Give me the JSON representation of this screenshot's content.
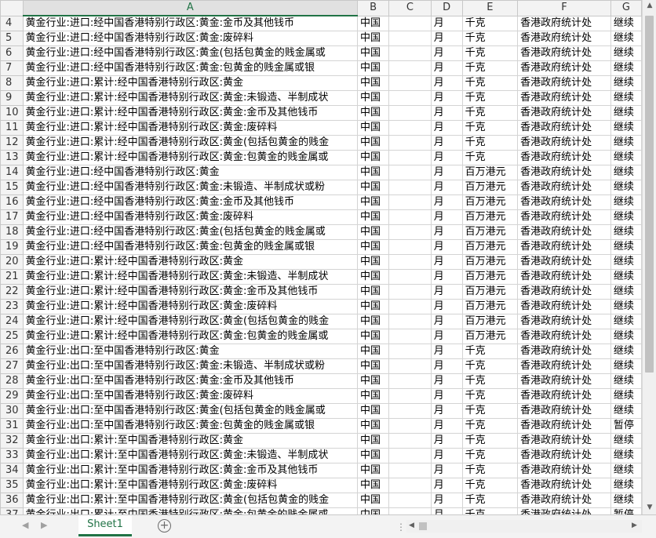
{
  "columns": [
    "A",
    "B",
    "C",
    "D",
    "E",
    "F",
    "G"
  ],
  "selected_column": "A",
  "rows": [
    [
      "4",
      "黄金行业:进口:经中国香港特别行政区:黄金:金币及其他钱币",
      "中国",
      "",
      "月",
      "千克",
      "香港政府统计处",
      "继续"
    ],
    [
      "5",
      "黄金行业:进口:经中国香港特别行政区:黄金:废碎料",
      "中国",
      "",
      "月",
      "千克",
      "香港政府统计处",
      "继续"
    ],
    [
      "6",
      "黄金行业:进口:经中国香港特别行政区:黄金(包括包黄金的贱金属或",
      "中国",
      "",
      "月",
      "千克",
      "香港政府统计处",
      "继续"
    ],
    [
      "7",
      "黄金行业:进口:经中国香港特别行政区:黄金:包黄金的贱金属或银",
      "中国",
      "",
      "月",
      "千克",
      "香港政府统计处",
      "继续"
    ],
    [
      "8",
      "黄金行业:进口:累计:经中国香港特别行政区:黄金",
      "中国",
      "",
      "月",
      "千克",
      "香港政府统计处",
      "继续"
    ],
    [
      "9",
      "黄金行业:进口:累计:经中国香港特别行政区:黄金:未锻造、半制成状",
      "中国",
      "",
      "月",
      "千克",
      "香港政府统计处",
      "继续"
    ],
    [
      "10",
      "黄金行业:进口:累计:经中国香港特别行政区:黄金:金币及其他钱币",
      "中国",
      "",
      "月",
      "千克",
      "香港政府统计处",
      "继续"
    ],
    [
      "11",
      "黄金行业:进口:累计:经中国香港特别行政区:黄金:废碎料",
      "中国",
      "",
      "月",
      "千克",
      "香港政府统计处",
      "继续"
    ],
    [
      "12",
      "黄金行业:进口:累计:经中国香港特别行政区:黄金(包括包黄金的贱金",
      "中国",
      "",
      "月",
      "千克",
      "香港政府统计处",
      "继续"
    ],
    [
      "13",
      "黄金行业:进口:累计:经中国香港特别行政区:黄金:包黄金的贱金属或",
      "中国",
      "",
      "月",
      "千克",
      "香港政府统计处",
      "继续"
    ],
    [
      "14",
      "黄金行业:进口:经中国香港特别行政区:黄金",
      "中国",
      "",
      "月",
      "百万港元",
      "香港政府统计处",
      "继续"
    ],
    [
      "15",
      "黄金行业:进口:经中国香港特别行政区:黄金:未锻造、半制成状或粉",
      "中国",
      "",
      "月",
      "百万港元",
      "香港政府统计处",
      "继续"
    ],
    [
      "16",
      "黄金行业:进口:经中国香港特别行政区:黄金:金币及其他钱币",
      "中国",
      "",
      "月",
      "百万港元",
      "香港政府统计处",
      "继续"
    ],
    [
      "17",
      "黄金行业:进口:经中国香港特别行政区:黄金:废碎料",
      "中国",
      "",
      "月",
      "百万港元",
      "香港政府统计处",
      "继续"
    ],
    [
      "18",
      "黄金行业:进口:经中国香港特别行政区:黄金(包括包黄金的贱金属或",
      "中国",
      "",
      "月",
      "百万港元",
      "香港政府统计处",
      "继续"
    ],
    [
      "19",
      "黄金行业:进口:经中国香港特别行政区:黄金:包黄金的贱金属或银",
      "中国",
      "",
      "月",
      "百万港元",
      "香港政府统计处",
      "继续"
    ],
    [
      "20",
      "黄金行业:进口:累计:经中国香港特别行政区:黄金",
      "中国",
      "",
      "月",
      "百万港元",
      "香港政府统计处",
      "继续"
    ],
    [
      "21",
      "黄金行业:进口:累计:经中国香港特别行政区:黄金:未锻造、半制成状",
      "中国",
      "",
      "月",
      "百万港元",
      "香港政府统计处",
      "继续"
    ],
    [
      "22",
      "黄金行业:进口:累计:经中国香港特别行政区:黄金:金币及其他钱币",
      "中国",
      "",
      "月",
      "百万港元",
      "香港政府统计处",
      "继续"
    ],
    [
      "23",
      "黄金行业:进口:累计:经中国香港特别行政区:黄金:废碎料",
      "中国",
      "",
      "月",
      "百万港元",
      "香港政府统计处",
      "继续"
    ],
    [
      "24",
      "黄金行业:进口:累计:经中国香港特别行政区:黄金(包括包黄金的贱金",
      "中国",
      "",
      "月",
      "百万港元",
      "香港政府统计处",
      "继续"
    ],
    [
      "25",
      "黄金行业:进口:累计:经中国香港特别行政区:黄金:包黄金的贱金属或",
      "中国",
      "",
      "月",
      "百万港元",
      "香港政府统计处",
      "继续"
    ],
    [
      "26",
      "黄金行业:出口:至中国香港特别行政区:黄金",
      "中国",
      "",
      "月",
      "千克",
      "香港政府统计处",
      "继续"
    ],
    [
      "27",
      "黄金行业:出口:至中国香港特别行政区:黄金:未锻造、半制成状或粉",
      "中国",
      "",
      "月",
      "千克",
      "香港政府统计处",
      "继续"
    ],
    [
      "28",
      "黄金行业:出口:至中国香港特别行政区:黄金:金币及其他钱币",
      "中国",
      "",
      "月",
      "千克",
      "香港政府统计处",
      "继续"
    ],
    [
      "29",
      "黄金行业:出口:至中国香港特别行政区:黄金:废碎料",
      "中国",
      "",
      "月",
      "千克",
      "香港政府统计处",
      "继续"
    ],
    [
      "30",
      "黄金行业:出口:至中国香港特别行政区:黄金(包括包黄金的贱金属或",
      "中国",
      "",
      "月",
      "千克",
      "香港政府统计处",
      "继续"
    ],
    [
      "31",
      "黄金行业:出口:至中国香港特别行政区:黄金:包黄金的贱金属或银",
      "中国",
      "",
      "月",
      "千克",
      "香港政府统计处",
      "暂停"
    ],
    [
      "32",
      "黄金行业:出口:累计:至中国香港特别行政区:黄金",
      "中国",
      "",
      "月",
      "千克",
      "香港政府统计处",
      "继续"
    ],
    [
      "33",
      "黄金行业:出口:累计:至中国香港特别行政区:黄金:未锻造、半制成状",
      "中国",
      "",
      "月",
      "千克",
      "香港政府统计处",
      "继续"
    ],
    [
      "34",
      "黄金行业:出口:累计:至中国香港特别行政区:黄金:金币及其他钱币",
      "中国",
      "",
      "月",
      "千克",
      "香港政府统计处",
      "继续"
    ],
    [
      "35",
      "黄金行业:出口:累计:至中国香港特别行政区:黄金:废碎料",
      "中国",
      "",
      "月",
      "千克",
      "香港政府统计处",
      "继续"
    ],
    [
      "36",
      "黄金行业:出口:累计:至中国香港特别行政区:黄金(包括包黄金的贱金",
      "中国",
      "",
      "月",
      "千克",
      "香港政府统计处",
      "继续"
    ],
    [
      "37",
      "黄金行业:出口:累计:至中国香港特别行政区:黄金:包黄金的贱金属或",
      "中国",
      "",
      "月",
      "千克",
      "香港政府统计处",
      "暂停"
    ]
  ],
  "sheet_tab": "Sheet1",
  "accent_color": "#217346"
}
